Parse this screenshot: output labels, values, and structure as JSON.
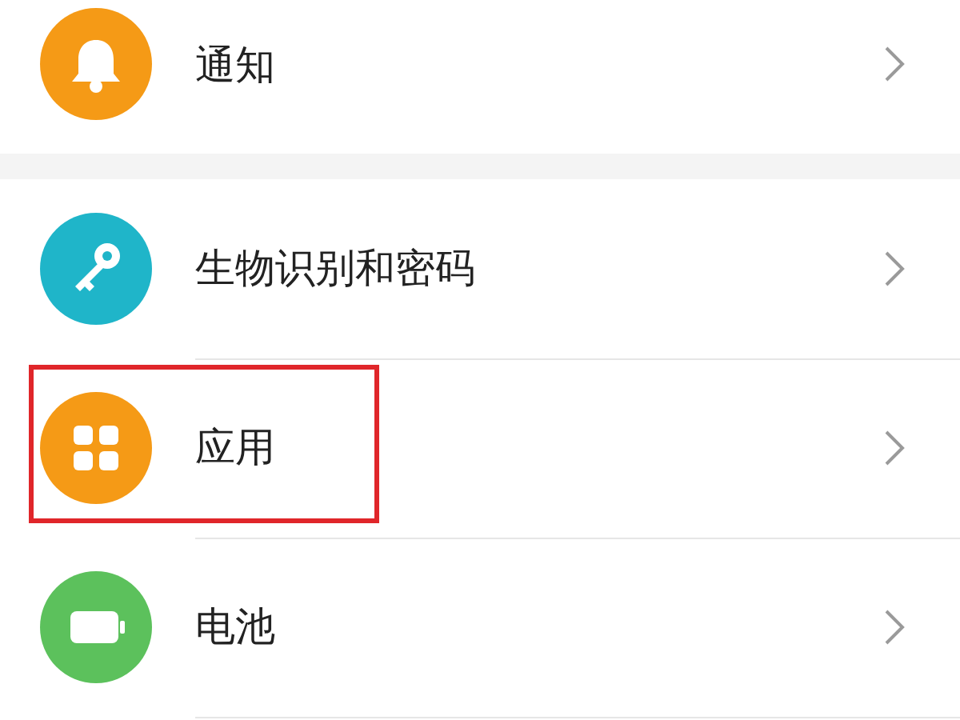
{
  "groups": [
    {
      "items": [
        {
          "label": "通知",
          "kind": "bell",
          "color": "#f59a16",
          "highlighted": false
        }
      ]
    },
    {
      "items": [
        {
          "label": "生物识别和密码",
          "kind": "key",
          "color": "#1fb5c9",
          "highlighted": false
        },
        {
          "label": "应用",
          "kind": "apps",
          "color": "#f59a16",
          "highlighted": true
        },
        {
          "label": "电池",
          "kind": "battery",
          "color": "#5cc15c",
          "highlighted": false
        }
      ]
    }
  ]
}
